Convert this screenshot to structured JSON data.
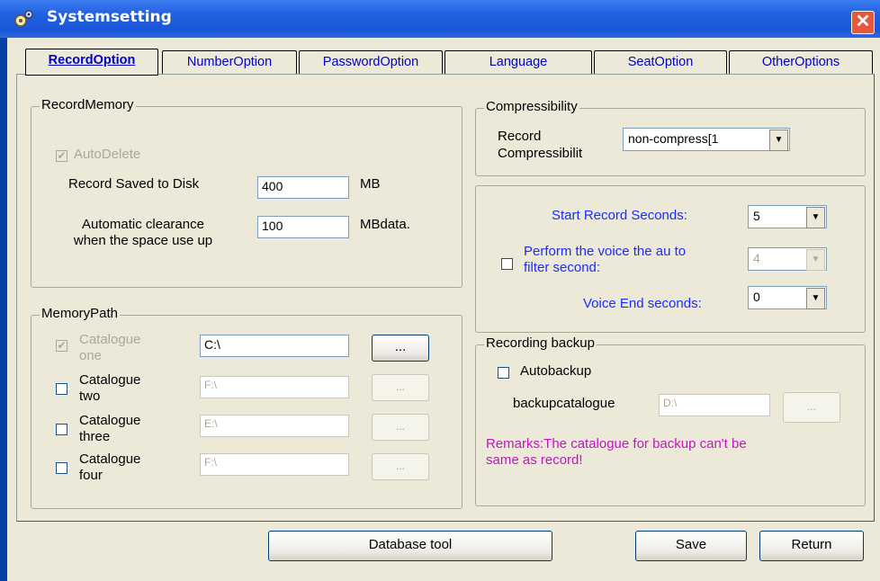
{
  "window": {
    "title": "Systemsetting",
    "close_label": "✕",
    "icon": "gear-icon"
  },
  "tabs": [
    {
      "label": "RecordOption",
      "active": true
    },
    {
      "label": "NumberOption"
    },
    {
      "label": "PasswordOption"
    },
    {
      "label": "Language"
    },
    {
      "label": "SeatOption"
    },
    {
      "label": "OtherOptions"
    }
  ],
  "record_memory": {
    "legend": "RecordMemory",
    "autodelete_label": "AutoDelete",
    "saved_label": "Record Saved to Disk",
    "saved_value": "400",
    "saved_unit": "MB",
    "clear_label_1": "Automatic clearance",
    "clear_label_2": "when the space use up",
    "clear_value": "100",
    "clear_unit": "MBdata."
  },
  "memory_path": {
    "legend": "MemoryPath",
    "rows": [
      {
        "label_1": "Catalogue",
        "label_2": "one",
        "value": "C:\\",
        "browse": "...",
        "checked": true
      },
      {
        "label_1": "Catalogue",
        "label_2": "two",
        "value": "F:\\",
        "browse": "..."
      },
      {
        "label_1": "Catalogue",
        "label_2": "three",
        "value": "E:\\",
        "browse": "..."
      },
      {
        "label_1": "Catalogue",
        "label_2": "four",
        "value": "F:\\",
        "browse": "..."
      }
    ]
  },
  "compressibility": {
    "legend": "Compressibility",
    "label_1": "Record",
    "label_2": "Compressibilit",
    "value": "non-compress[1"
  },
  "record_seconds": {
    "start_label": "Start Record Seconds:",
    "start_value": "5",
    "filter_label_1": "Perform the voice the au to",
    "filter_label_2": "filter second:",
    "filter_value": "4",
    "end_label": "Voice End seconds:",
    "end_value": "0"
  },
  "backup": {
    "legend": "Recording backup",
    "autobackup_label": "Autobackup",
    "catalogue_label": "backupcatalogue",
    "catalogue_value": "D:\\",
    "browse": "...",
    "remark_1": "Remarks:The catalogue for backup can't be",
    "remark_2": "same as record!"
  },
  "footer": {
    "database_tool": "Database tool",
    "save": "Save",
    "return": "Return"
  }
}
